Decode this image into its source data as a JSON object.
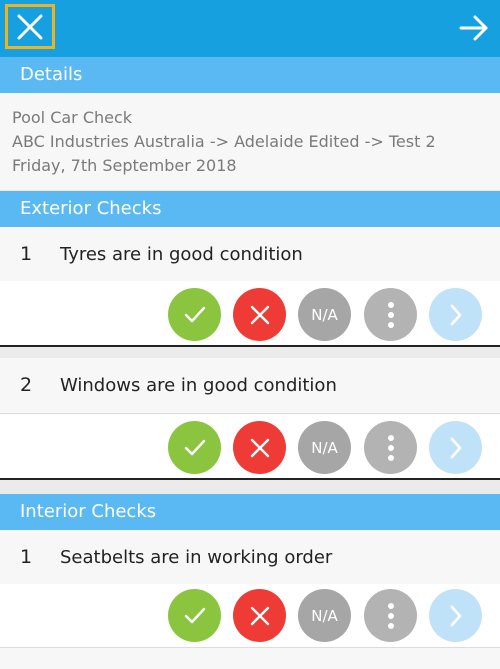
{
  "header": {
    "close_icon": "close-icon",
    "next_icon": "arrow-right-icon",
    "bar_color": "#16a0e0",
    "focus_color": "#f0b31d"
  },
  "details": {
    "title": "Details",
    "lines": [
      "Pool Car Check",
      "ABC Industries Australia -> Adelaide Edited -> Test 2",
      "Friday, 7th September 2018"
    ]
  },
  "sections": [
    {
      "title": "Exterior Checks",
      "items": [
        {
          "number": "1",
          "text": "Tyres are in good condition"
        },
        {
          "number": "2",
          "text": "Windows are in good condition"
        }
      ]
    },
    {
      "title": "Interior Checks",
      "items": [
        {
          "number": "1",
          "text": "Seatbelts are in working order"
        }
      ]
    }
  ],
  "actions": {
    "pass_icon": "check-icon",
    "fail_icon": "cross-icon",
    "na_label": "N/A",
    "more_icon": "more-vertical-icon",
    "open_icon": "chevron-right-icon",
    "colors": {
      "pass": "#8bc53f",
      "fail": "#ef3b35",
      "na": "#a6a6a6",
      "more": "#b3b3b3",
      "open": "#c0e2f8"
    }
  }
}
